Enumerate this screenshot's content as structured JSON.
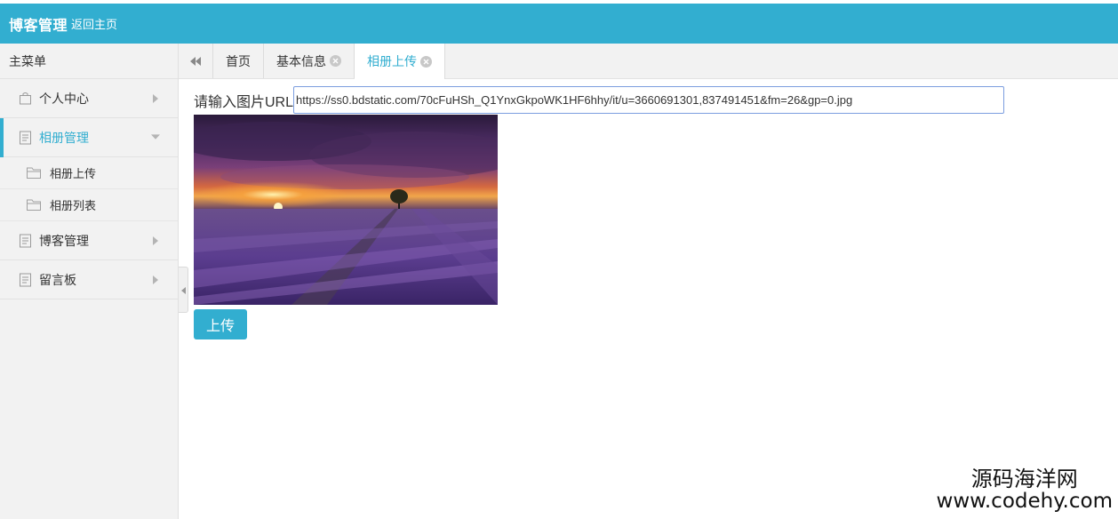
{
  "header": {
    "title": "博客管理",
    "back_link": "返回主页"
  },
  "sidebar": {
    "heading": "主菜单",
    "items": [
      {
        "label": "个人中心",
        "icon": "bag-icon",
        "expanded": false
      },
      {
        "label": "相册管理",
        "icon": "document-icon",
        "expanded": true,
        "children": [
          {
            "label": "相册上传",
            "icon": "folder-icon"
          },
          {
            "label": "相册列表",
            "icon": "folder-icon"
          }
        ]
      },
      {
        "label": "博客管理",
        "icon": "document-icon",
        "expanded": false
      },
      {
        "label": "留言板",
        "icon": "document-icon",
        "expanded": false
      }
    ]
  },
  "tabs": [
    {
      "label": "首页",
      "closable": false
    },
    {
      "label": "基本信息",
      "closable": true
    },
    {
      "label": "相册上传",
      "closable": true,
      "active": true
    }
  ],
  "main": {
    "url_label": "请输入图片URL",
    "url_value": "https://ss0.bdstatic.com/70cFuHSh_Q1YnxGkpoWK1HF6hhy/it/u=3660691301,837491451&fm=26&gp=0.jpg",
    "upload_label": "上传"
  },
  "watermark": {
    "line1": "源码海洋网",
    "line2": "www.codehy.com"
  },
  "colors": {
    "accent": "#32aed0",
    "sidebar_bg": "#f2f2f2",
    "input_border": "#7b9ddf"
  }
}
